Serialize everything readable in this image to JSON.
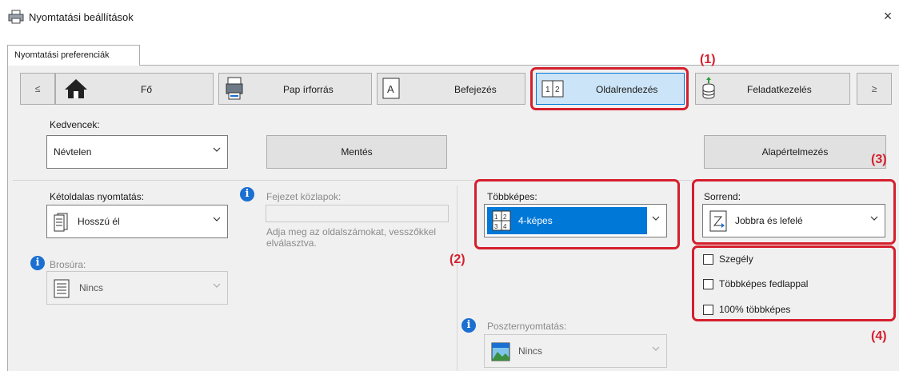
{
  "window": {
    "title": "Nyomtatási beállítások",
    "close_glyph": "×",
    "tab": "Nyomtatási preferenciák"
  },
  "nav": {
    "prev_glyph": "≤",
    "next_glyph": "≥",
    "items": [
      {
        "label": "Fő",
        "icon": "home-icon"
      },
      {
        "label": "Pap írforrás",
        "icon": "paper-source-icon"
      },
      {
        "label": "Befejezés",
        "icon": "finishing-icon"
      },
      {
        "label": "Oldalrendezés",
        "icon": "layout-icon",
        "selected": true
      },
      {
        "label": "Feladatkezelés",
        "icon": "job-handling-icon"
      }
    ]
  },
  "favorites": {
    "label": "Kedvencek:",
    "value": "Névtelen",
    "save_label": "Mentés",
    "defaults_label": "Alapértelmezés"
  },
  "duplex": {
    "label": "Kétoldalas nyomtatás:",
    "value": "Hosszú él"
  },
  "chapter_inserts": {
    "label": "Fejezet közlapok:",
    "value": "",
    "hint": "Adja meg az oldalszámokat, vesszőkkel elválasztva."
  },
  "booklet": {
    "label": "Brosúra:",
    "value": "Nincs"
  },
  "nup": {
    "label": "Többképes:",
    "value": "4-képes"
  },
  "order": {
    "label": "Sorrend:",
    "value": "Jobbra és lefelé"
  },
  "options": [
    {
      "label": "Szegély",
      "checked": false
    },
    {
      "label": "Többképes fedlappal",
      "checked": false
    },
    {
      "label": "100% többképes",
      "checked": false
    }
  ],
  "poster": {
    "label": "Poszternyomtatás:",
    "value": "Nincs"
  },
  "callouts": [
    "(1)",
    "(2)",
    "(3)",
    "(4)"
  ],
  "colors": {
    "highlight_red": "#d51f2d",
    "selection_blue": "#0078d7",
    "info_blue": "#1a6fd1"
  }
}
